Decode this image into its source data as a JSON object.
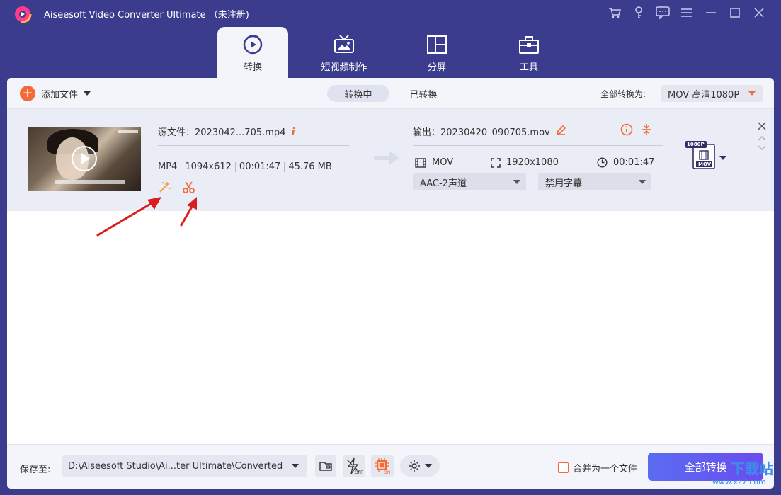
{
  "window": {
    "title": "Aiseesoft Video Converter Ultimate （未注册)",
    "icons": [
      "cart-icon",
      "key-icon",
      "chat-icon",
      "menu-icon",
      "minimize-icon",
      "maximize-icon",
      "close-icon"
    ]
  },
  "nav": {
    "tabs": [
      {
        "label": "转换",
        "icon": "convert-icon",
        "active": true
      },
      {
        "label": "短视频制作",
        "icon": "mv-icon",
        "active": false
      },
      {
        "label": "分屏",
        "icon": "collage-icon",
        "active": false
      },
      {
        "label": "工具",
        "icon": "toolbox-icon",
        "active": false
      }
    ]
  },
  "toolbar": {
    "add_files": "添加文件",
    "tab_converting": "转换中",
    "tab_converted": "已转换",
    "convert_all_to_label": "全部转换为:",
    "convert_all_format": "MOV 高清1080P"
  },
  "file": {
    "source_name": "源文件：2023042...705.mp4",
    "format": "MP4",
    "resolution": "1094x612",
    "duration": "00:01:47",
    "size": "45.76 MB",
    "output_name": "输出：20230420_090705.mov",
    "out_format": "MOV",
    "out_resolution": "1920x1080",
    "out_duration": "00:01:47",
    "audio_track": "AAC-2声道",
    "subtitle": "禁用字幕",
    "badge_top": "1080P",
    "badge_bottom": "MOV"
  },
  "bottom": {
    "save_to_label": "保存至:",
    "save_path": "D:\\Aiseesoft Studio\\Ai...ter Ultimate\\Converted",
    "merge_label": "合并为一个文件",
    "convert_all_button": "全部转换"
  },
  "watermark": {
    "top": "下载站",
    "bottom": "www.xz7.com"
  },
  "colors": {
    "frame": "#3c3c8e",
    "accent": "#f46a36",
    "button": "#5a6cf0"
  }
}
